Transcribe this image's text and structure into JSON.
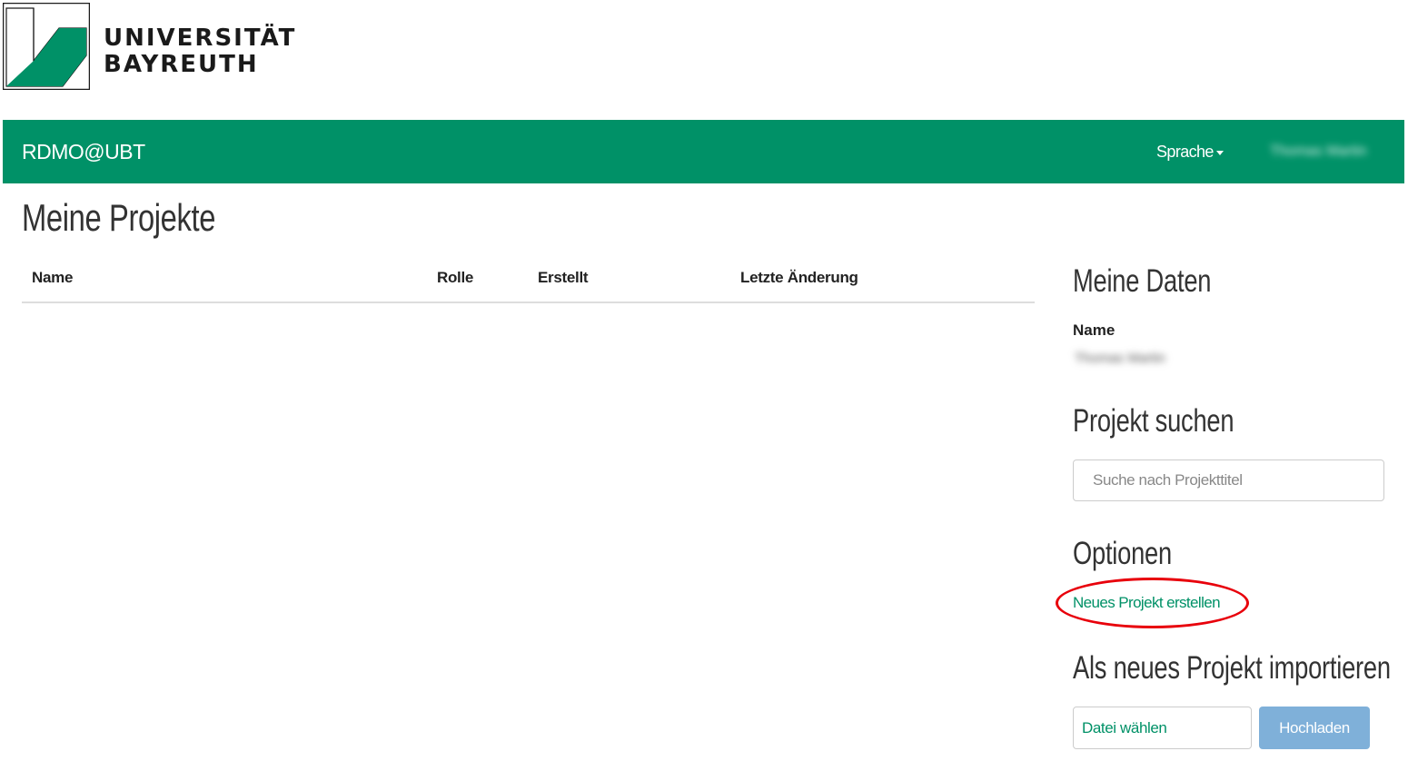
{
  "logo": {
    "line1": "UNIVERSITÄT",
    "line2": "BAYREUTH",
    "colors": {
      "green": "#009167",
      "outline": "#1a1a1a"
    }
  },
  "navbar": {
    "brand": "RDMO@UBT",
    "language_menu": "Sprache",
    "user_menu": "Thomas Martin",
    "background": "#009167"
  },
  "main": {
    "title": "Meine Projekte",
    "table": {
      "columns": [
        "Name",
        "Rolle",
        "Erstellt",
        "Letzte Änderung"
      ],
      "rows": []
    }
  },
  "sidebar": {
    "my_data": {
      "heading": "Meine Daten",
      "name_label": "Name",
      "name_value": "Thomas Martin"
    },
    "search": {
      "heading": "Projekt suchen",
      "placeholder": "Suche nach Projekttitel",
      "value": ""
    },
    "options": {
      "heading": "Optionen",
      "new_project": "Neues Projekt erstellen"
    },
    "import": {
      "heading": "Als neues Projekt importieren",
      "choose_file": "Datei wählen",
      "upload": "Hochladen"
    }
  },
  "annotation": {
    "highlight_color": "#e8000b",
    "highlight_target": "new-project-link"
  }
}
